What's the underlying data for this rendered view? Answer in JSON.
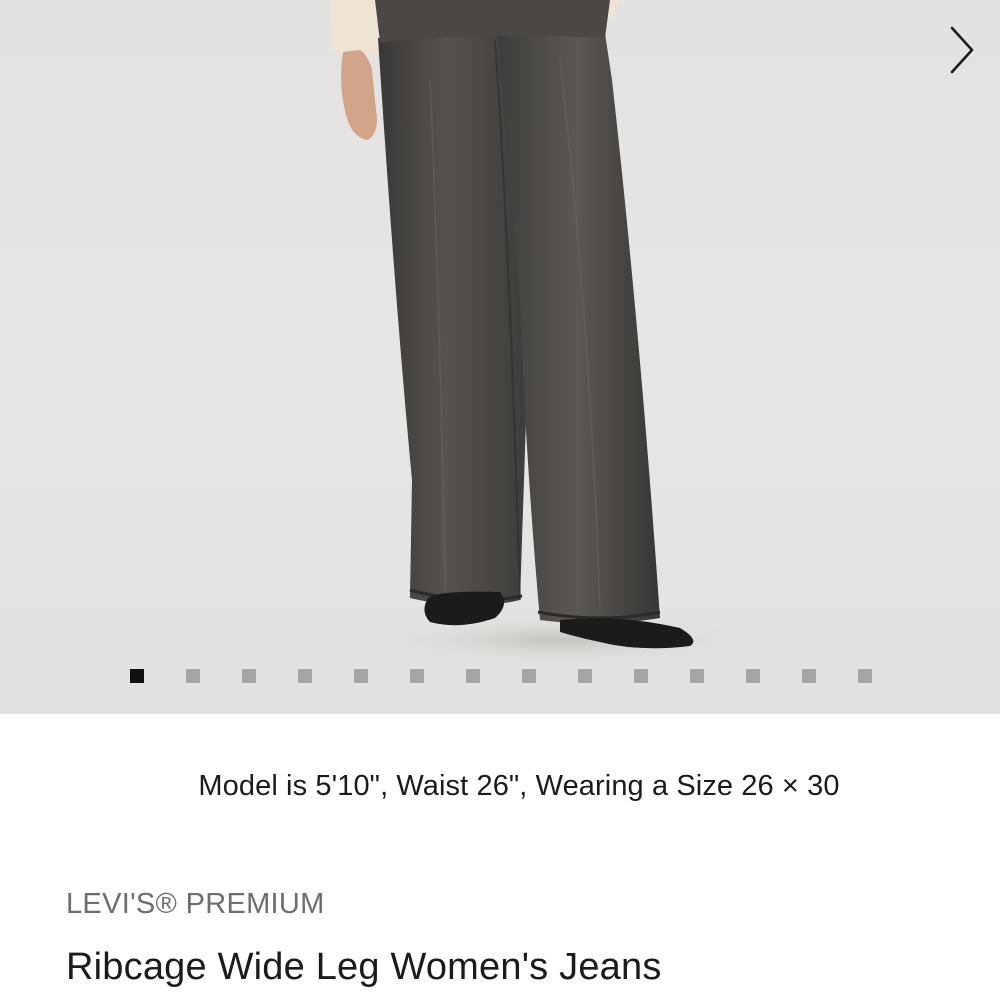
{
  "carousel": {
    "image_alt": "Model wearing black wide leg jeans with cream blazer and black boots",
    "next_icon": "chevron-right-icon",
    "dot_count": 14,
    "active_index": 0
  },
  "model_info": "Model is 5'10\", Waist 26\", Wearing a Size 26 × 30",
  "product": {
    "brand": "LEVI'S® PREMIUM",
    "title": "Ribcage Wide Leg Women's Jeans"
  },
  "colors": {
    "active_dot": "#111111",
    "inactive_dot": "#a9a7a6",
    "brand_text": "#6e6e6e"
  }
}
